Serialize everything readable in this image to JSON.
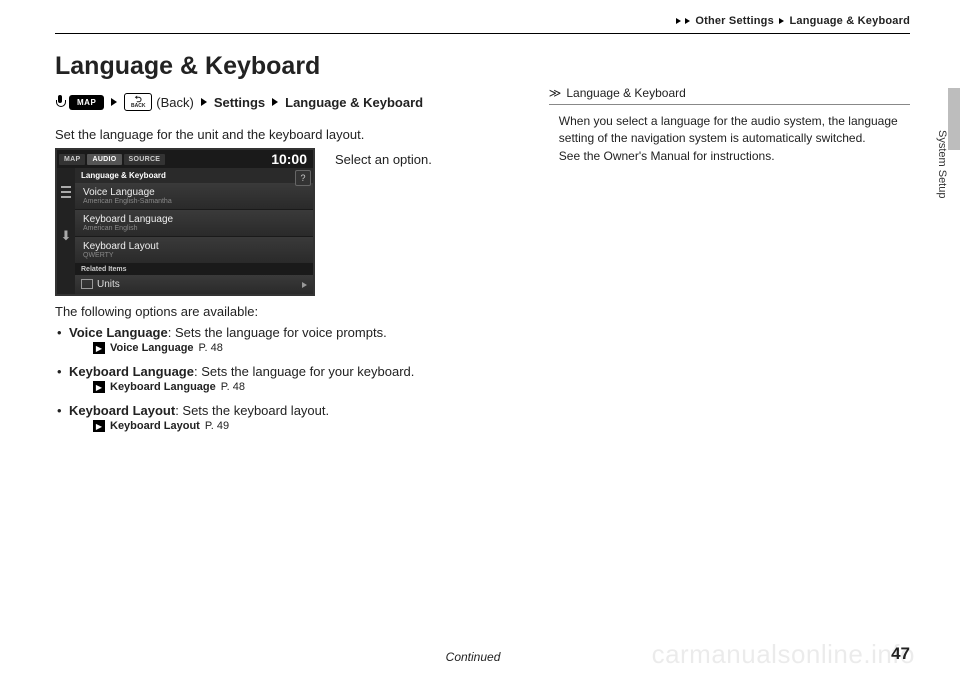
{
  "breadcrumb": {
    "a": "Other Settings",
    "b": "Language & Keyboard"
  },
  "title": "Language & Keyboard",
  "path": {
    "map": "MAP",
    "back_word": "(Back)",
    "back_chip": "BACK",
    "settings": "Settings",
    "lang": "Language & Keyboard"
  },
  "desc": "Set the language for the unit and the keyboard layout.",
  "instruction": "Select an option.",
  "screen": {
    "tabs": {
      "map": "MAP",
      "audio": "AUDIO",
      "source": "SOURCE"
    },
    "clock": "10:00",
    "header": "Language & Keyboard",
    "help": "?",
    "items": [
      {
        "t": "Voice Language",
        "s": "American English-Samantha"
      },
      {
        "t": "Keyboard Language",
        "s": "American English"
      },
      {
        "t": "Keyboard Layout",
        "s": "QWERTY"
      }
    ],
    "related": "Related Items",
    "units": "Units"
  },
  "opts_intro": "The following options are available:",
  "opts": [
    {
      "name": "Voice Language",
      "rest": ": Sets the language for voice prompts.",
      "ref": "Voice Language",
      "page": "P. 48"
    },
    {
      "name": "Keyboard Language",
      "rest": ": Sets the language for your keyboard.",
      "ref": "Keyboard Language",
      "page": "P. 48"
    },
    {
      "name": "Keyboard Layout",
      "rest": ": Sets the keyboard layout.",
      "ref": "Keyboard Layout",
      "page": "P. 49"
    }
  ],
  "note": {
    "head": "Language & Keyboard",
    "p1": "When you select a language for the audio system, the language setting of the navigation system is automatically switched.",
    "p2": "See the Owner's Manual for instructions."
  },
  "side_label": "System Setup",
  "footer": {
    "cont": "Continued",
    "page": "47"
  },
  "watermark": "carmanualsonline.info"
}
